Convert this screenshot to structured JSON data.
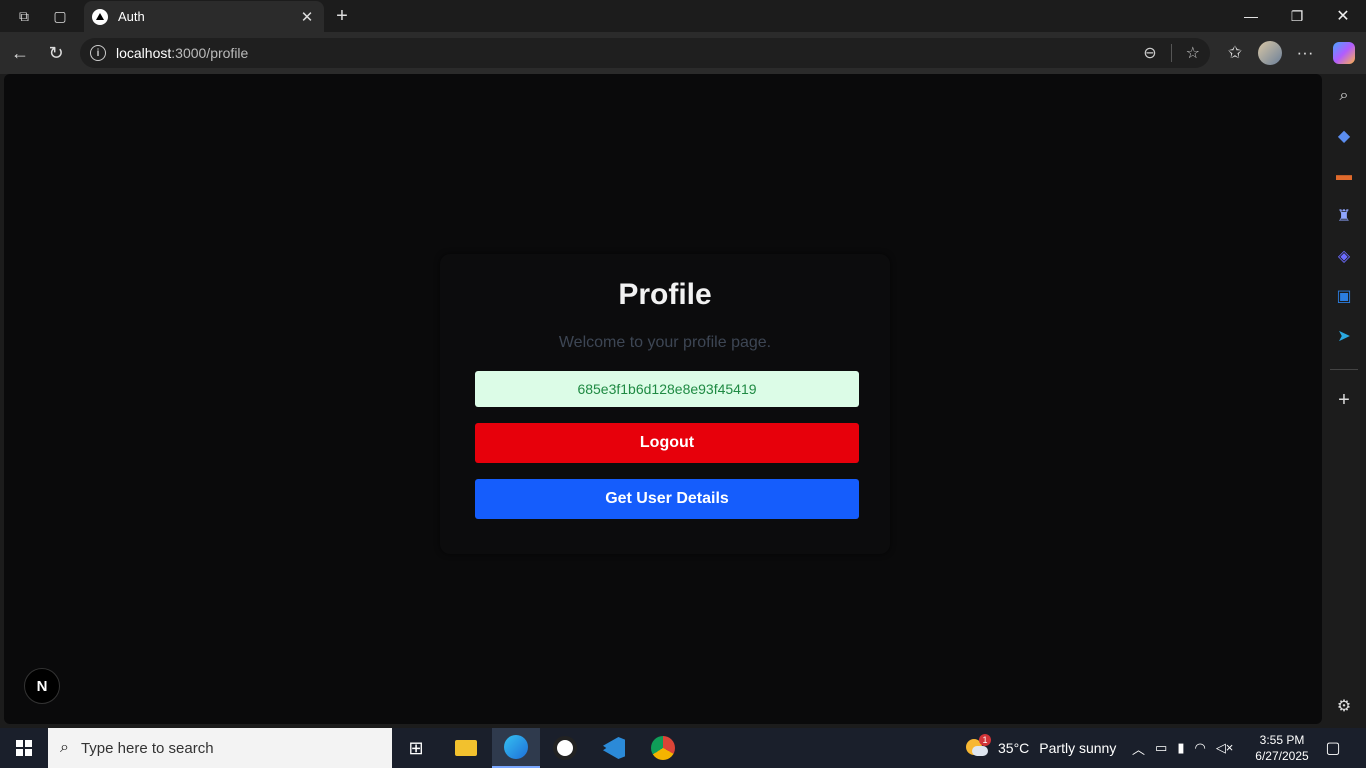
{
  "browser": {
    "tab_title": "Auth",
    "url_host": "localhost",
    "url_path": ":3000/profile"
  },
  "page": {
    "title": "Profile",
    "subtitle": "Welcome to your profile page.",
    "user_id": "685e3f1b6d128e8e93f45419",
    "logout_label": "Logout",
    "details_label": "Get User Details",
    "next_badge": "N"
  },
  "taskbar": {
    "search_placeholder": "Type here to search",
    "temperature": "35°C",
    "weather": "Partly sunny",
    "weather_badge": "1",
    "time": "3:55 PM",
    "date": "6/27/2025"
  },
  "colors": {
    "logout": "#e7000b",
    "details": "#155dfc",
    "uid_bg": "#dcfce7",
    "uid_text": "#1f8a43"
  }
}
